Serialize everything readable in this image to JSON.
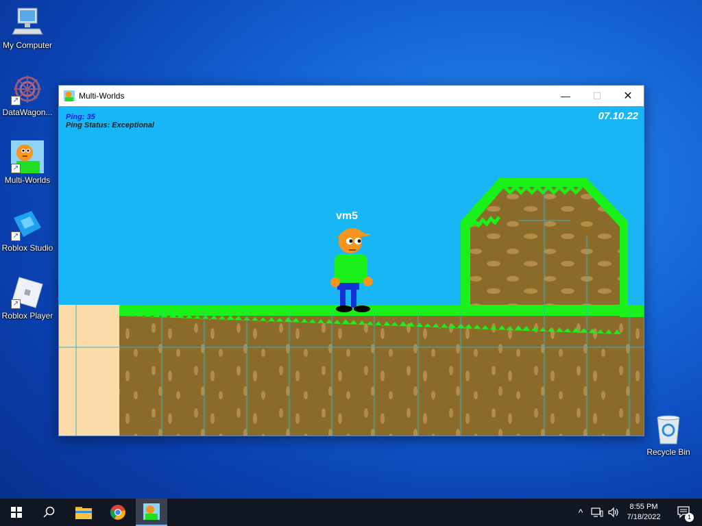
{
  "desktop": {
    "icons": [
      {
        "label": "My Computer",
        "icon": "computer-icon"
      },
      {
        "label": "DataWagon...",
        "icon": "datawagon-icon"
      },
      {
        "label": "Multi-Worlds",
        "icon": "multiworlds-icon"
      },
      {
        "label": "Roblox Studio",
        "icon": "roblox-studio-icon"
      },
      {
        "label": "Roblox Player",
        "icon": "roblox-player-icon"
      },
      {
        "label": "Recycle Bin",
        "icon": "recycle-bin-icon"
      }
    ]
  },
  "window": {
    "title": "Multi-Worlds",
    "controls": {
      "minimize": "—",
      "maximize": "☐",
      "close": "✕"
    }
  },
  "game": {
    "ping": "Ping: 35",
    "ping_status": "Ping Status: Exceptional",
    "date": "07.10.22",
    "player_name": "vm5",
    "colors": {
      "sky": "#18b6f4",
      "grass": "#1af01a",
      "dirt": "#8b6b2a",
      "sand": "#fbdca8",
      "ping": "#1a1ae6"
    }
  },
  "taskbar": {
    "time": "8:55 PM",
    "date": "7/18/2022",
    "notification_count": "1",
    "apps": [
      "start-icon",
      "search-icon",
      "file-explorer-icon",
      "chrome-icon",
      "multiworlds-icon"
    ]
  }
}
